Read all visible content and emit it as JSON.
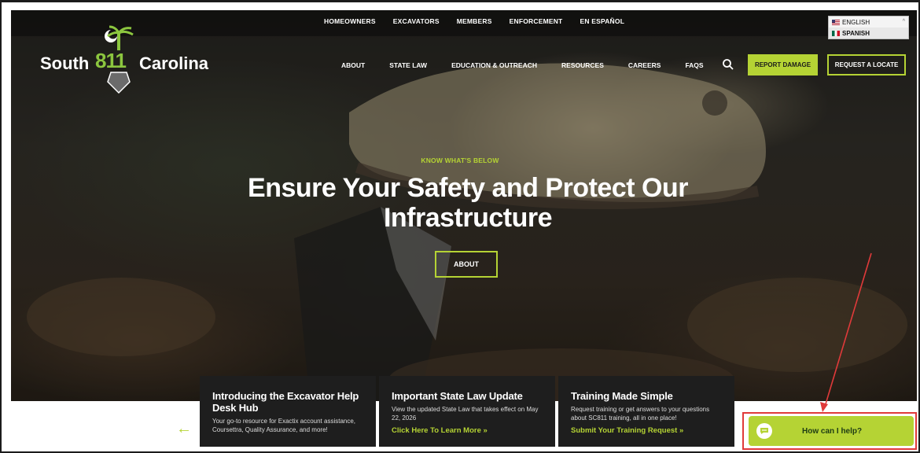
{
  "top_nav": [
    "HOMEOWNERS",
    "EXCAVATORS",
    "MEMBERS",
    "ENFORCEMENT",
    "EN ESPAÑOL"
  ],
  "language": {
    "options": [
      "ENGLISH",
      "SPANISH"
    ]
  },
  "logo": {
    "word1": "South",
    "number": "811",
    "word2": "Carolina"
  },
  "main_nav": [
    "ABOUT",
    "STATE LAW",
    "EDUCATION & OUTREACH",
    "RESOURCES",
    "CAREERS",
    "FAQS"
  ],
  "buttons": {
    "report_damage": "REPORT DAMAGE",
    "request_locate": "REQUEST A LOCATE"
  },
  "hero": {
    "eyebrow": "KNOW WHAT'S BELOW",
    "headline": "Ensure Your Safety and Protect Our Infrastructure",
    "cta": "ABOUT"
  },
  "cards": [
    {
      "title": "Introducing the Excavator Help Desk Hub",
      "desc": "Your go-to resource for Exactix account assistance, Coursettra, Quality Assurance, and more!",
      "link": ""
    },
    {
      "title": "Important State Law Update",
      "desc": "View the updated State Law that takes effect on May 22, 2026",
      "link": "Click Here To Learn More »"
    },
    {
      "title": "Training Made Simple",
      "desc": "Request training or get answers to your questions about SC811 training, all in one place!",
      "link": "Submit Your Training Request »"
    }
  ],
  "chat": {
    "label": "How can I help?"
  },
  "colors": {
    "accent": "#b5d334",
    "annotation": "#e03a3a"
  },
  "icons": [
    "search-icon",
    "chat-bubble-icon",
    "arrow-left-icon",
    "palmetto-icon",
    "shovel-icon"
  ]
}
